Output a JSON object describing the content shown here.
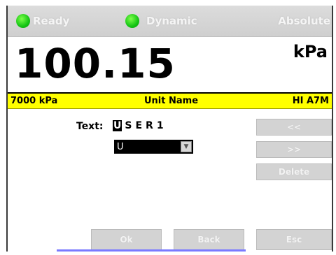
{
  "status": {
    "ready_label": "Ready",
    "dynamic_label": "Dynamic",
    "absolute_label": "Absolute"
  },
  "reading": {
    "value": "100.15",
    "unit": "kPa"
  },
  "info": {
    "range": "7000 kPa",
    "unit_name": "Unit Name",
    "model": "HI A7M"
  },
  "editor": {
    "text_label": "Text:",
    "chars": [
      "U",
      "S",
      "E",
      "R",
      "1"
    ],
    "selected_index": 0,
    "selected_char": "U"
  },
  "buttons": {
    "prev": "<<",
    "next": ">>",
    "delete": "Delete",
    "ok": "Ok",
    "back": "Back",
    "esc": "Esc"
  },
  "colors": {
    "info_bar": "#ffff00",
    "led": "#14c414"
  }
}
